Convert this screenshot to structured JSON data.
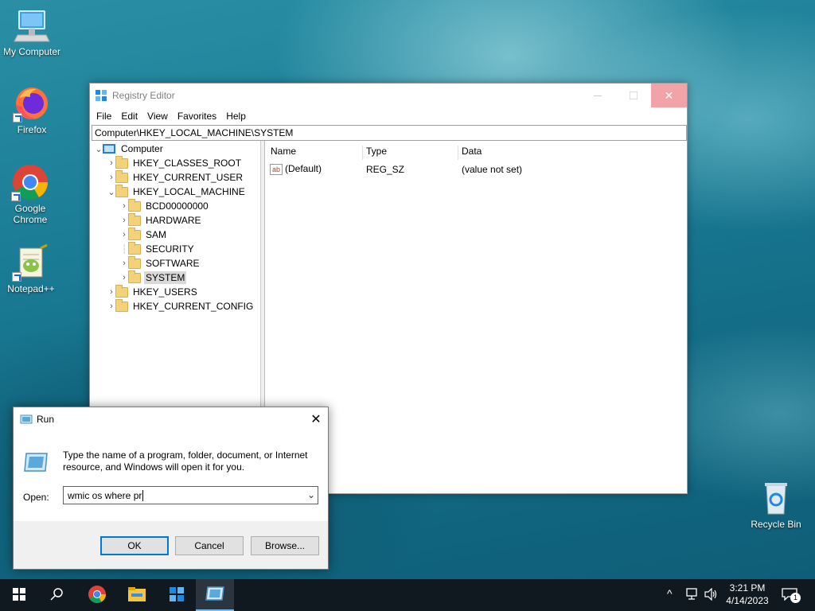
{
  "desktop": {
    "icons": [
      {
        "label": "My Computer"
      },
      {
        "label": "Firefox"
      },
      {
        "label": "Google Chrome"
      },
      {
        "label": "Notepad++"
      },
      {
        "label": "Recycle Bin"
      }
    ]
  },
  "regedit": {
    "title": "Registry Editor",
    "menu": [
      "File",
      "Edit",
      "View",
      "Favorites",
      "Help"
    ],
    "address": "Computer\\HKEY_LOCAL_MACHINE\\SYSTEM",
    "tree": {
      "root": "Computer",
      "hives": [
        "HKEY_CLASSES_ROOT",
        "HKEY_CURRENT_USER",
        "HKEY_LOCAL_MACHINE",
        "HKEY_USERS",
        "HKEY_CURRENT_CONFIG"
      ],
      "hklm_children": [
        "BCD00000000",
        "HARDWARE",
        "SAM",
        "SECURITY",
        "SOFTWARE",
        "SYSTEM"
      ],
      "selected": "SYSTEM"
    },
    "columns": [
      "Name",
      "Type",
      "Data"
    ],
    "values": [
      {
        "name": "(Default)",
        "type": "REG_SZ",
        "data": "(value not set)",
        "icon": "reg-string-icon"
      }
    ]
  },
  "run": {
    "title": "Run",
    "description": "Type the name of a program, folder, document, or Internet resource, and Windows will open it for you.",
    "open_label": "Open:",
    "input_value": "wmic os where pr",
    "buttons": {
      "ok": "OK",
      "cancel": "Cancel",
      "browse": "Browse..."
    }
  },
  "taskbar": {
    "time": "3:21 PM",
    "date": "4/14/2023",
    "notification_count": "1"
  },
  "colors": {
    "accent": "#0078d7",
    "close_hover": "#e81123",
    "taskbar": "#101820"
  }
}
